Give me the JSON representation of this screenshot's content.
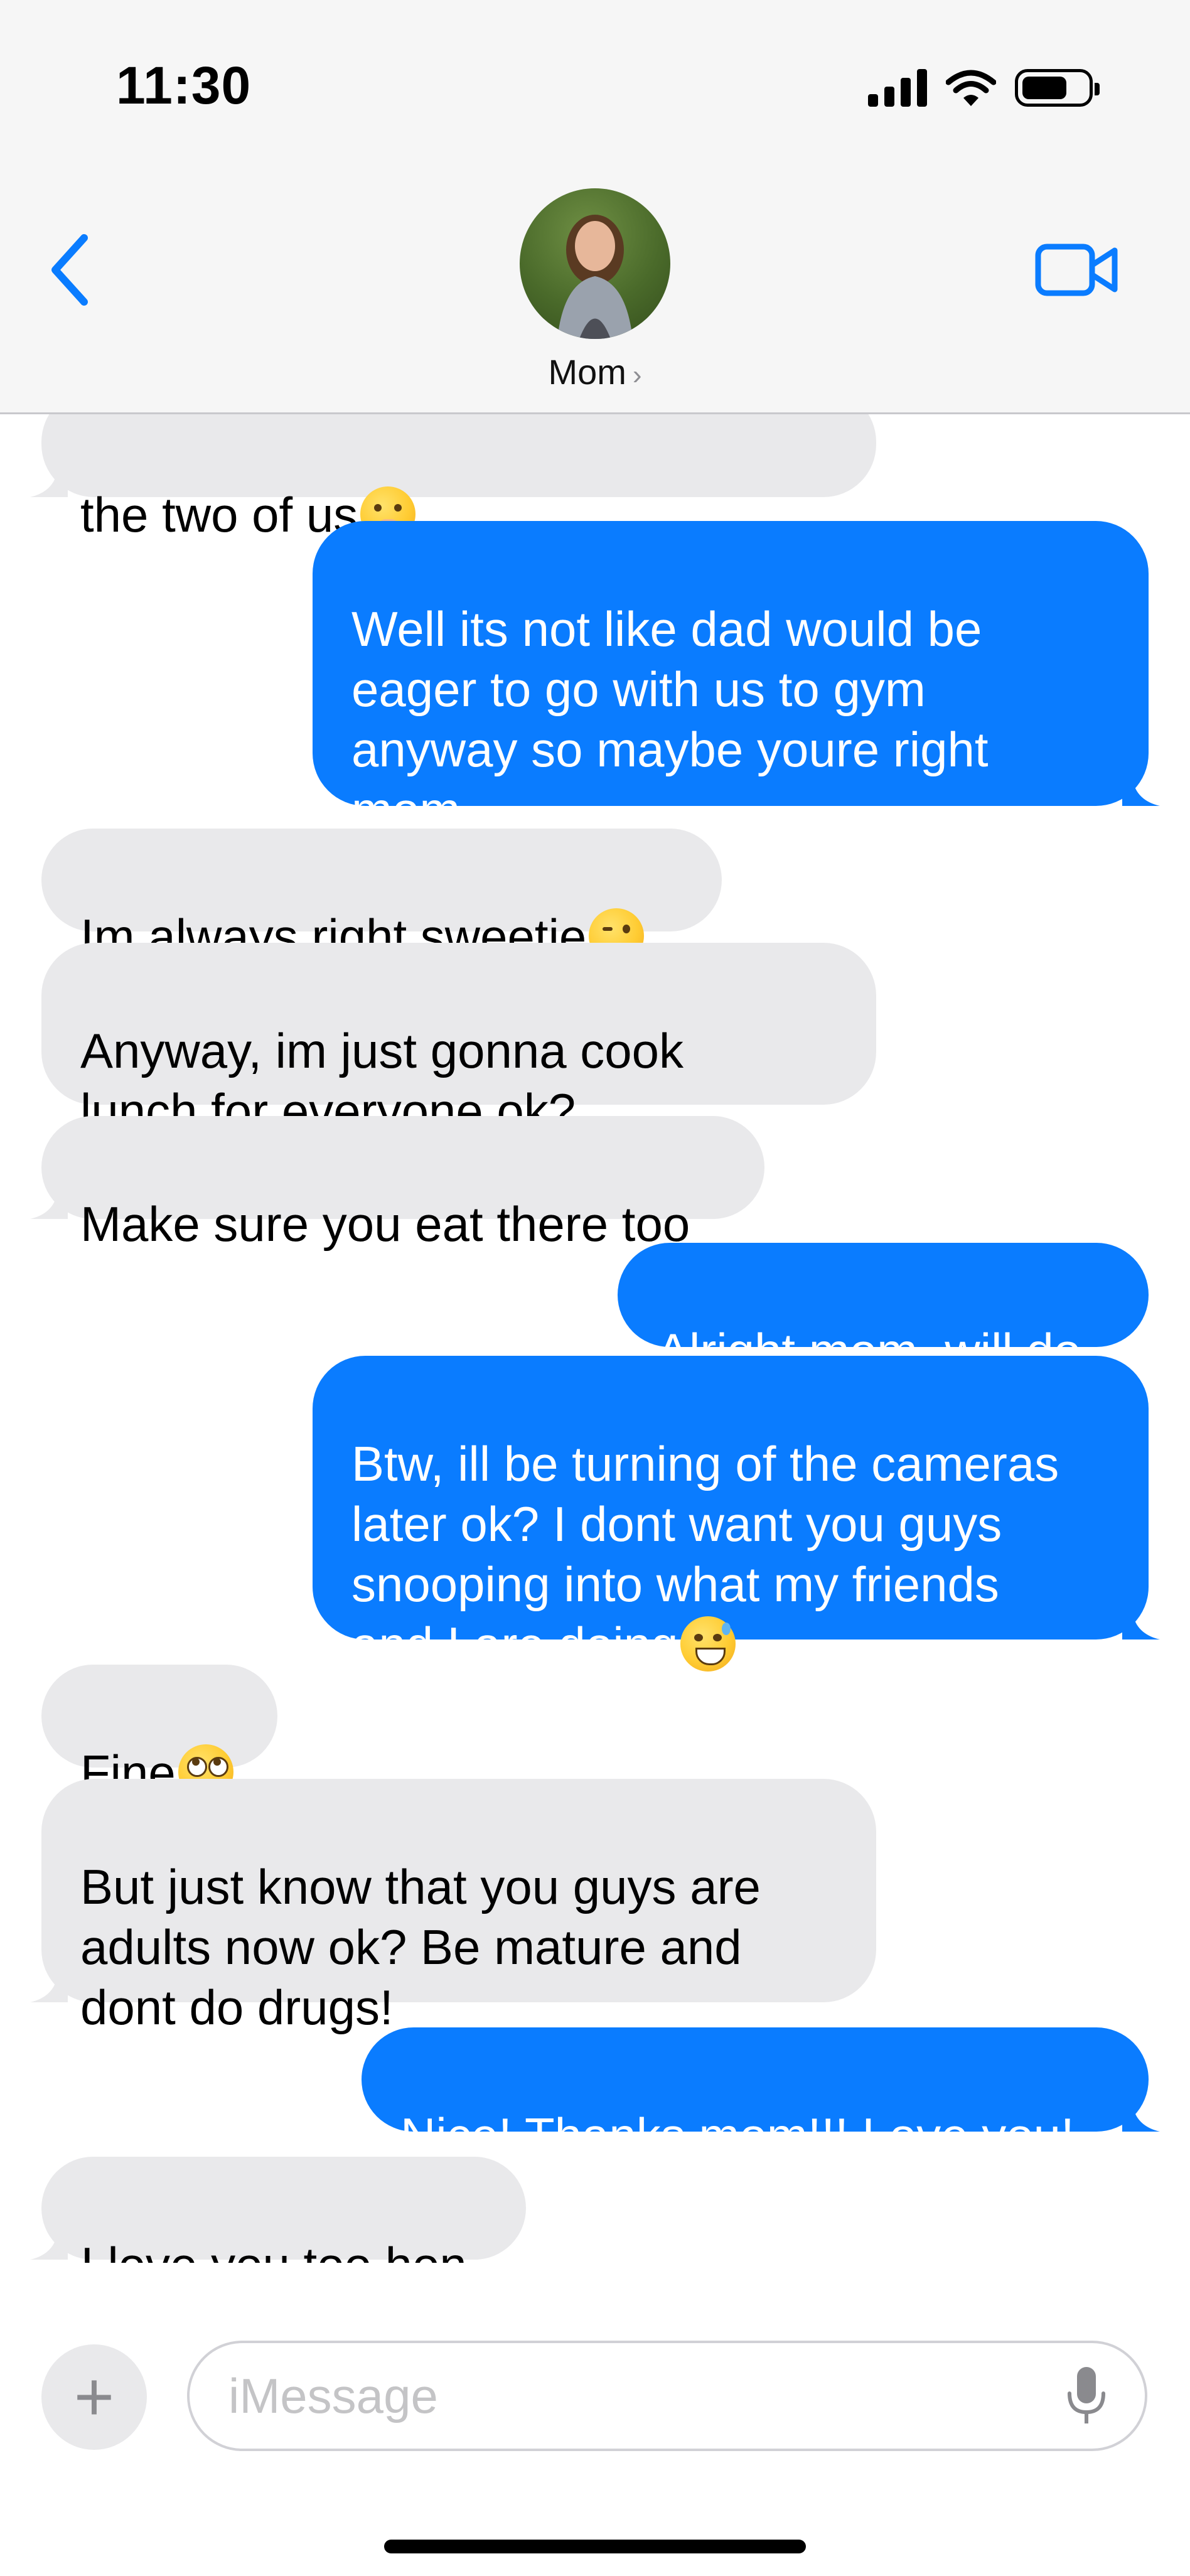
{
  "status_bar": {
    "time": "11:30",
    "battery_level": 0.7
  },
  "header": {
    "contact_name": "Mom",
    "chevron": "›",
    "icons": {
      "back": "chevron-left-icon",
      "video": "video-camera-icon"
    },
    "accent": "#0a7cff"
  },
  "messages": [
    {
      "dir": "in",
      "text": "the two of us",
      "emoji": "hand-over-mouth"
    },
    {
      "dir": "out",
      "text": "Well its not like dad would be\neager to go with us to gym\nanyway so maybe youre right\nmom"
    },
    {
      "dir": "in",
      "text": "Im always right sweetie",
      "emoji": "winking-face"
    },
    {
      "dir": "in",
      "text": "Anyway, im just gonna cook\nlunch for everyone ok?"
    },
    {
      "dir": "in",
      "text": "Make sure you eat there too"
    },
    {
      "dir": "out",
      "text": "Alright mom, will do"
    },
    {
      "dir": "out",
      "text": "Btw, ill be turning of the cameras\nlater ok? I dont want you guys\nsnooping into what my friends\nand I are doing",
      "emoji": "grinning-sweat"
    },
    {
      "dir": "in",
      "text": "Fine",
      "emoji": "eye-roll"
    },
    {
      "dir": "in",
      "text": "But just know that you guys are\nadults now ok? Be mature and\ndont do drugs!"
    },
    {
      "dir": "out",
      "text": "Nice! Thanks mom!!! Love you!"
    },
    {
      "dir": "in",
      "text": "I love you too hon"
    }
  ],
  "compose": {
    "placeholder": "iMessage",
    "plus_label": "+",
    "icons": {
      "plus": "plus-icon",
      "mic": "microphone-icon"
    }
  },
  "colors": {
    "incoming_bubble": "#e9e9eb",
    "outgoing_bubble": "#0a7cff",
    "header_bg": "#f6f6f6"
  }
}
